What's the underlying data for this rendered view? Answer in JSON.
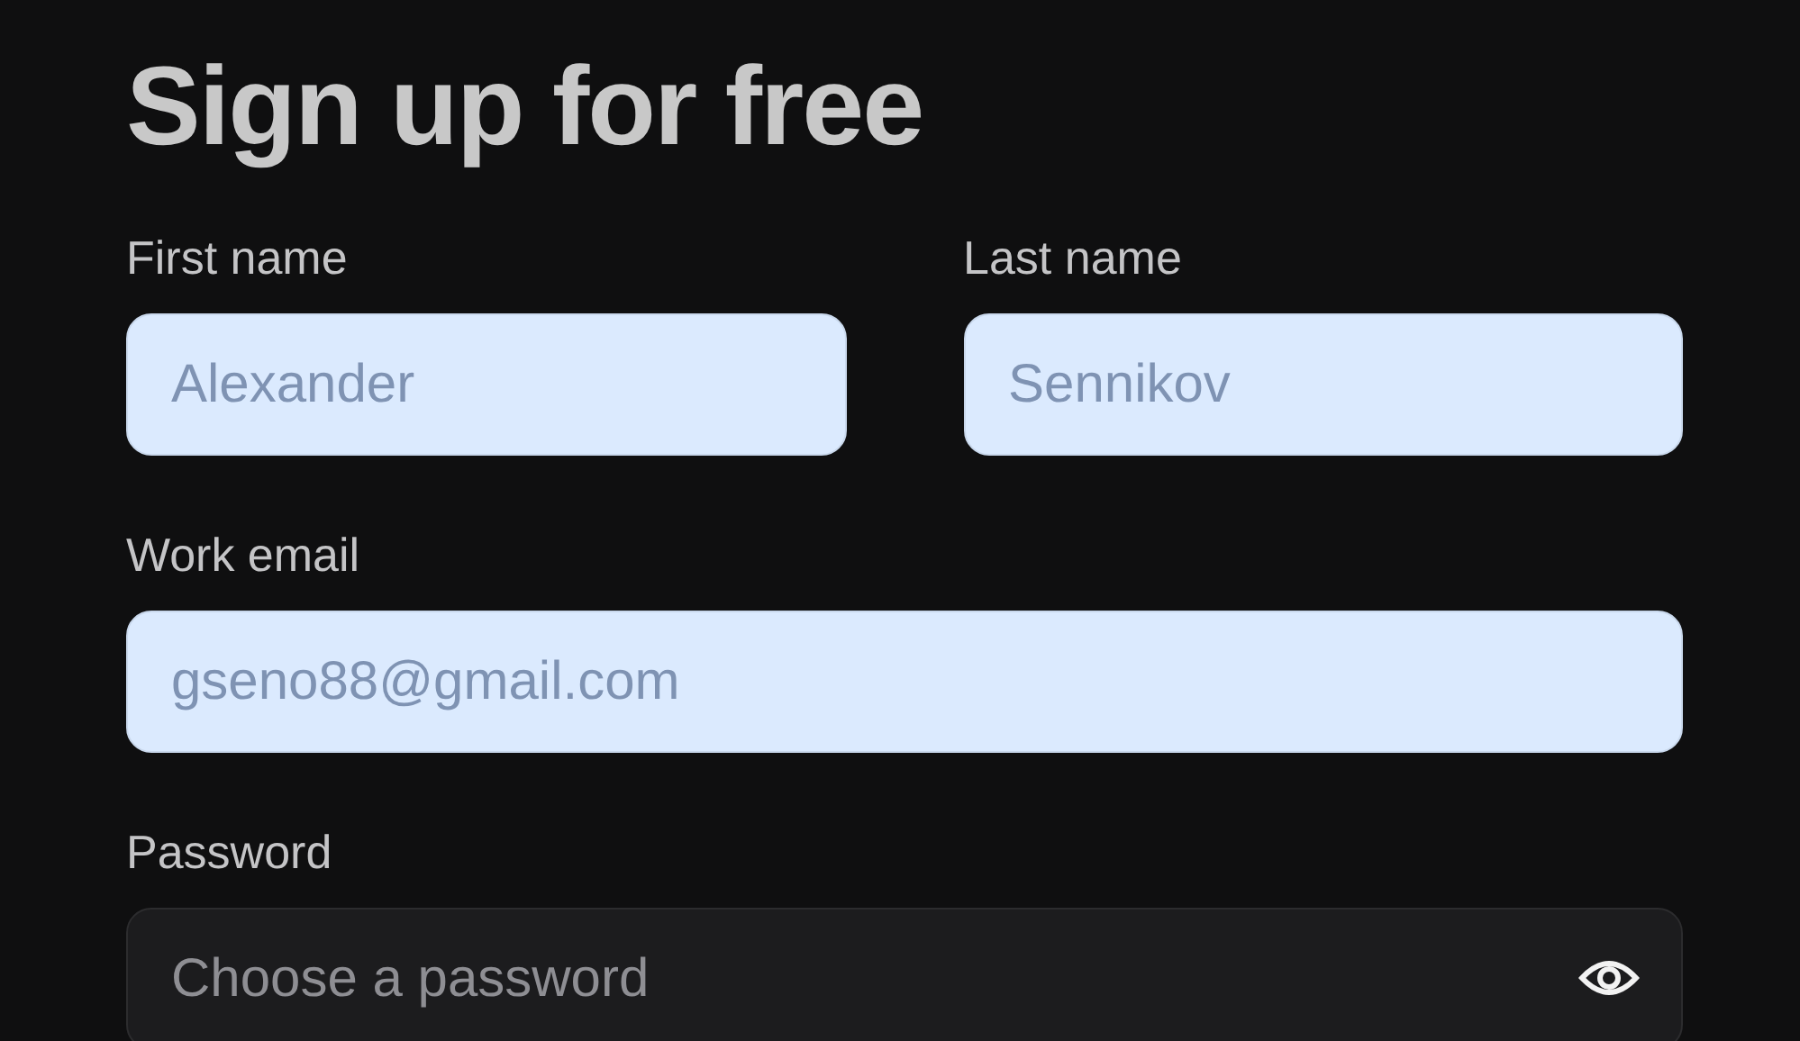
{
  "title": "Sign up for free",
  "rows": [
    [
      {
        "label": "First name",
        "kind": "filled",
        "value": "Alexander"
      },
      {
        "label": "Last name",
        "kind": "filled",
        "value": "Sennikov"
      }
    ],
    [
      {
        "label": "Work email",
        "kind": "filled",
        "value": "gseno88@gmail.com"
      }
    ],
    [
      {
        "label": "Password",
        "kind": "password",
        "placeholder": "Choose a password"
      }
    ]
  ]
}
